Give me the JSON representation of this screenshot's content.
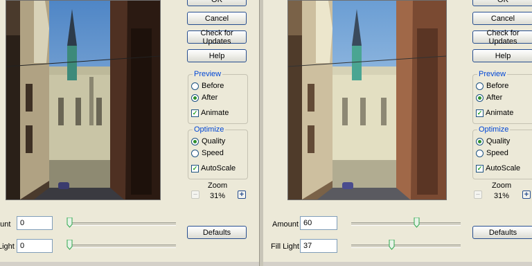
{
  "left_dialog": {
    "buttons": {
      "ok": "OK",
      "cancel": "Cancel",
      "check_updates": "Check for Updates",
      "help": "Help",
      "defaults": "Defaults"
    },
    "preview": {
      "title": "Preview",
      "before": "Before",
      "after": "After",
      "animate": "Animate",
      "selected": "After",
      "animate_checked": true
    },
    "optimize": {
      "title": "Optimize",
      "quality": "Quality",
      "speed": "Speed",
      "autoscale": "AutoScale",
      "selected": "Quality",
      "autoscale_checked": true
    },
    "zoom": {
      "label": "Zoom",
      "value": "31%"
    },
    "amount": {
      "label": "ount",
      "value": "0",
      "slider_fraction": 0.0
    },
    "fill_light": {
      "label": "Light",
      "value": "0",
      "slider_fraction": 0.0
    }
  },
  "right_dialog": {
    "buttons": {
      "ok": "OK",
      "cancel": "Cancel",
      "check_updates": "Check for Updates",
      "help": "Help",
      "defaults": "Defaults"
    },
    "preview": {
      "title": "Preview",
      "before": "Before",
      "after": "After",
      "animate": "Animate",
      "selected": "After",
      "animate_checked": true
    },
    "optimize": {
      "title": "Optimize",
      "quality": "Quality",
      "speed": "Speed",
      "autoscale": "AutoScale",
      "selected": "Quality",
      "autoscale_checked": true
    },
    "zoom": {
      "label": "Zoom",
      "value": "31%"
    },
    "amount": {
      "label": "Amount",
      "value": "60",
      "slider_fraction": 0.6
    },
    "fill_light": {
      "label": "Fill Light",
      "value": "37",
      "slider_fraction": 0.37
    }
  },
  "colors": {
    "dialog_bg": "#ece9d8",
    "group_title": "#0046d5",
    "button_border": "#264d8f",
    "slider_thumb": "#2fa84f"
  },
  "icons": {
    "zoom_out": "minus-icon",
    "zoom_in": "plus-icon",
    "check": "checkmark-icon"
  }
}
